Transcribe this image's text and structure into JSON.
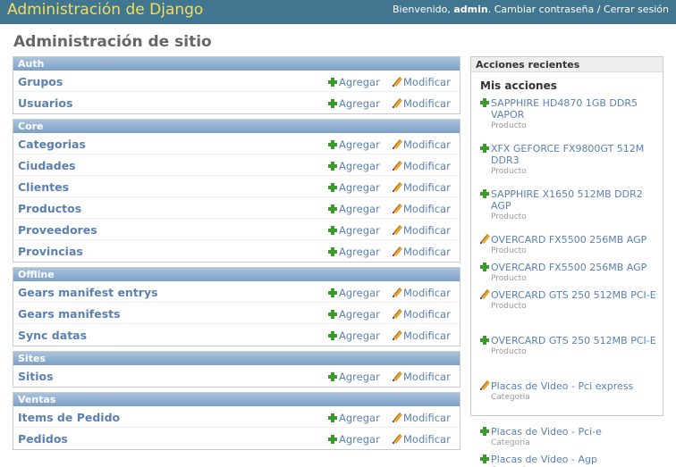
{
  "header": {
    "branding": "Administración de Django",
    "welcome": "Bienvenido,",
    "username": "admin",
    "change_password": "Cambiar contraseña",
    "separator": "/",
    "logout": "Cerrar sesión"
  },
  "page_title": "Administración de sitio",
  "links": {
    "add": "Agregar",
    "change": "Modificar"
  },
  "apps": [
    {
      "name": "Auth",
      "models": [
        "Grupos",
        "Usuarios"
      ]
    },
    {
      "name": "Core",
      "models": [
        "Categorias",
        "Ciudades",
        "Clientes",
        "Productos",
        "Proveedores",
        "Provincias"
      ]
    },
    {
      "name": "Offline",
      "models": [
        "Gears manifest entrys",
        "Gears manifests",
        "Sync datas"
      ]
    },
    {
      "name": "Sites",
      "models": [
        "Sitios"
      ]
    },
    {
      "name": "Ventas",
      "models": [
        "Items de Pedido",
        "Pedidos"
      ]
    }
  ],
  "recent_actions": {
    "caption": "Acciones recientes",
    "my_actions": "Mis acciones",
    "items": [
      {
        "icon": "add-icon",
        "title": "SAPPHIRE HD4870 1GB DDR5 VAPOR",
        "type": "Producto"
      },
      {
        "icon": "add-icon",
        "title": "XFX GEFORCE FX9800GT 512M DDR3",
        "type": "Producto"
      },
      {
        "icon": "add-icon",
        "title": "SAPPHIRE X1650 512MB DDR2 AGP",
        "type": "Producto"
      },
      {
        "icon": "change-icon",
        "title": "OVERCARD FX5500 256MB AGP",
        "type": "Producto"
      },
      {
        "icon": "add-icon",
        "title": "OVERCARD FX5500 256MB AGP",
        "type": "Producto"
      },
      {
        "icon": "change-icon",
        "title": "OVERCARD GTS 250 512MB PCI-E",
        "type": "Producto"
      },
      {
        "icon": "add-icon",
        "title": "OVERCARD GTS 250 512MB PCI-E",
        "type": "Producto"
      },
      {
        "icon": "change-icon",
        "title": "Placas de Video - Pci express",
        "type": "Categoria"
      },
      {
        "icon": "add-icon",
        "title": "Placas de Video - Pci-e",
        "type": "Categoria"
      },
      {
        "icon": "add-icon",
        "title": "Placas de Video - Agp",
        "type": "Categoria"
      }
    ]
  },
  "colors": {
    "header_bg": "#417690",
    "branding": "#f5dd5d",
    "link": "#5b80b2",
    "caption_bg": "#7ca0c7"
  }
}
